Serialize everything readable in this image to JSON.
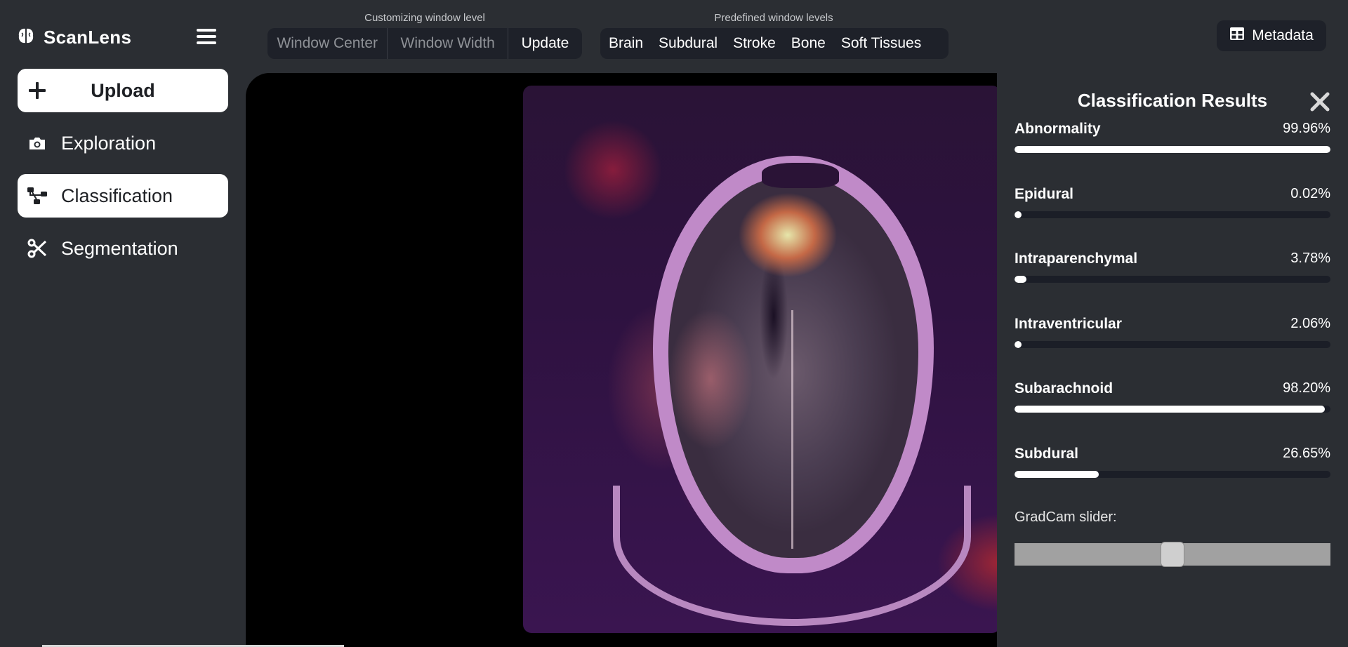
{
  "app": {
    "name": "ScanLens"
  },
  "sidebar": {
    "upload_label": "Upload",
    "items": [
      {
        "label": "Exploration",
        "icon": "camera-icon",
        "active": false
      },
      {
        "label": "Classification",
        "icon": "hierarchy-icon",
        "active": true
      },
      {
        "label": "Segmentation",
        "icon": "scissors-icon",
        "active": false
      }
    ]
  },
  "toolbar": {
    "custom_caption": "Customizing window level",
    "window_center_placeholder": "Window Center",
    "window_width_placeholder": "Window Width",
    "update_label": "Update",
    "predefined_caption": "Predefined window levels",
    "presets": [
      "Brain",
      "Subdural",
      "Stroke",
      "Bone",
      "Soft Tissues"
    ],
    "metadata_label": "Metadata"
  },
  "results": {
    "title": "Classification Results",
    "items": [
      {
        "label": "Abnormality",
        "value": "99.96%",
        "fraction": 0.9996
      },
      {
        "label": "Epidural",
        "value": "0.02%",
        "fraction": 0.0002
      },
      {
        "label": "Intraparenchymal",
        "value": "3.78%",
        "fraction": 0.0378
      },
      {
        "label": "Intraventricular",
        "value": "2.06%",
        "fraction": 0.0206
      },
      {
        "label": "Subarachnoid",
        "value": "98.20%",
        "fraction": 0.982
      },
      {
        "label": "Subdural",
        "value": "26.65%",
        "fraction": 0.2665
      }
    ],
    "slider_label": "GradCam slider:",
    "slider_fraction": 0.5
  },
  "colors": {
    "background": "#2b2e33",
    "panel_dark": "#1e2129",
    "accent": "#ffffff"
  }
}
